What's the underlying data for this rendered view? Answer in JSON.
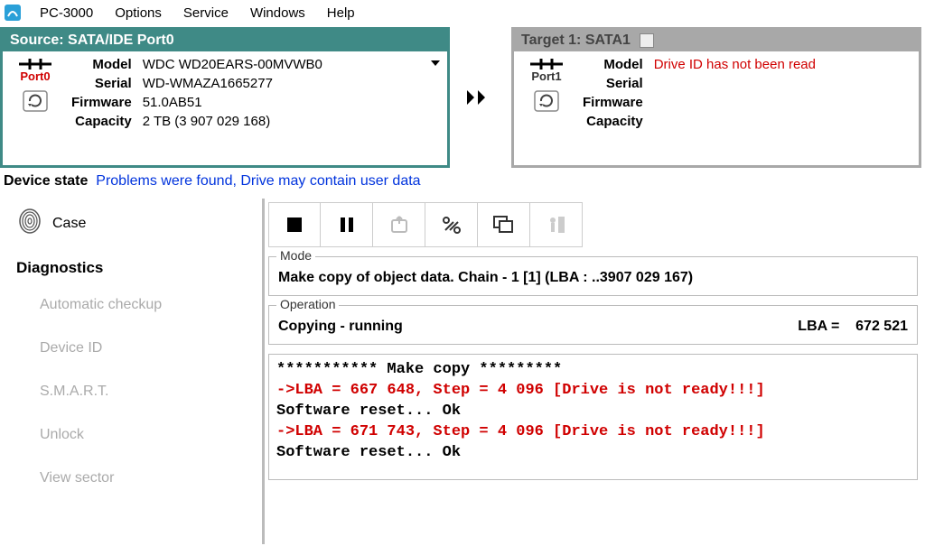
{
  "menu": {
    "app": "PC-3000",
    "items": [
      "Options",
      "Service",
      "Windows",
      "Help"
    ]
  },
  "source": {
    "title": "Source: SATA/IDE Port0",
    "port_label": "Port0",
    "model_lbl": "Model",
    "model": "WDC WD20EARS-00MVWB0",
    "serial_lbl": "Serial",
    "serial": "WD-WMAZA1665277",
    "firmware_lbl": "Firmware",
    "firmware": "51.0AB51",
    "capacity_lbl": "Capacity",
    "capacity": "2 TB (3 907 029 168)"
  },
  "target": {
    "title": "Target 1: SATA1",
    "port_label": "Port1",
    "model_lbl": "Model",
    "model": "Drive ID has not been read",
    "serial_lbl": "Serial",
    "serial": "",
    "firmware_lbl": "Firmware",
    "firmware": "",
    "capacity_lbl": "Capacity",
    "capacity": ""
  },
  "device_state": {
    "label": "Device state",
    "value": "Problems were found, Drive may contain user data"
  },
  "sidebar": {
    "case": "Case",
    "heading": "Diagnostics",
    "items": [
      "Automatic checkup",
      "Device ID",
      "S.M.A.R.T.",
      "Unlock",
      "View sector"
    ]
  },
  "mode": {
    "legend": "Mode",
    "text": "Make copy of object data. Chain - 1 [1] (LBA :   ..3907 029 167)"
  },
  "operation": {
    "legend": "Operation",
    "status": "Copying - running",
    "lba_label": "LBA =",
    "lba_value": "672 521"
  },
  "log": {
    "lines": [
      {
        "text": "*********** Make copy *********",
        "err": false
      },
      {
        "text": "->LBA =     667 648, Step =     4 096 [Drive is not ready!!!]",
        "err": true
      },
      {
        "text": "Software reset... Ok",
        "err": false
      },
      {
        "text": "->LBA =     671 743, Step =     4 096 [Drive is not ready!!!]",
        "err": true
      },
      {
        "text": "Software reset... Ok",
        "err": false
      }
    ]
  }
}
